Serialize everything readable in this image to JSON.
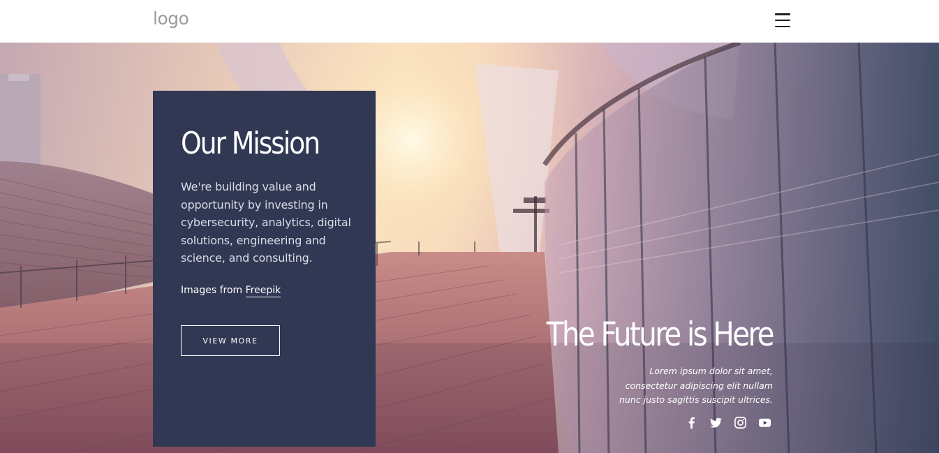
{
  "header": {
    "logo": "logo",
    "menu_icon": "hamburger-menu-icon"
  },
  "mission": {
    "title": "Our Mission",
    "text": "We're building value and opportunity by investing in cybersecurity, analytics, digital solutions, engineering and science, and consulting.",
    "credit_prefix": "Images from ",
    "credit_link": "Freepik",
    "button": "VIEW MORE"
  },
  "future": {
    "title": "The Future is Here",
    "text": "Lorem ipsum dolor sit amet, consectetur adipiscing elit nullam nunc justo sagittis suscipit ultrices."
  },
  "social": {
    "icons": [
      "facebook-icon",
      "twitter-icon",
      "instagram-icon",
      "youtube-icon"
    ]
  },
  "colors": {
    "card_background": "#313853",
    "text_on_dark": "#ffffff"
  }
}
